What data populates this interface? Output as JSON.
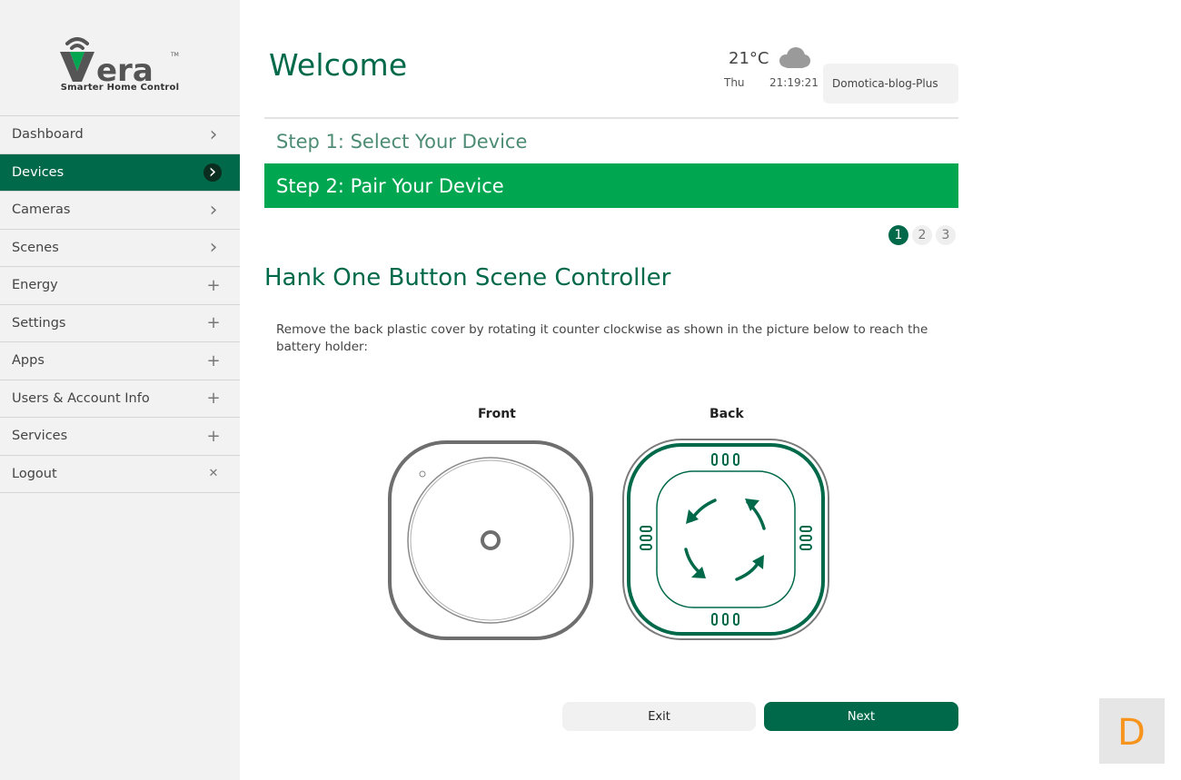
{
  "app": {
    "logo_text": "Vera",
    "logo_tm": "TM",
    "tagline": "Smarter Home Control"
  },
  "sidebar": {
    "items": [
      {
        "label": "Dashboard",
        "indicator": "chevron-right-icon",
        "active": false
      },
      {
        "label": "Devices",
        "indicator": "chevron-right-icon",
        "active": true
      },
      {
        "label": "Cameras",
        "indicator": "chevron-right-icon",
        "active": false
      },
      {
        "label": "Scenes",
        "indicator": "chevron-right-icon",
        "active": false
      },
      {
        "label": "Energy",
        "indicator": "plus-icon",
        "active": false
      },
      {
        "label": "Settings",
        "indicator": "plus-icon",
        "active": false
      },
      {
        "label": "Apps",
        "indicator": "plus-icon",
        "active": false
      },
      {
        "label": "Users & Account Info",
        "indicator": "plus-icon",
        "active": false
      },
      {
        "label": "Services",
        "indicator": "plus-icon",
        "active": false
      },
      {
        "label": "Logout",
        "indicator": "close-icon",
        "active": false
      }
    ]
  },
  "header": {
    "title": "Welcome",
    "temperature": "21°C",
    "weather_icon": "cloud-icon",
    "day": "Thu",
    "time": "21:19:21",
    "account_name": "Domotica-blog-Plus"
  },
  "wizard": {
    "step1_label": "Step 1: Select Your Device",
    "step2_label": "Step 2: Pair Your Device",
    "pages": [
      "1",
      "2",
      "3"
    ],
    "current_page": "1",
    "device_title": "Hank One Button Scene Controller",
    "instructions": "Remove the back plastic cover by rotating it counter clockwise as shown in the picture below to reach the battery holder:",
    "front_label": "Front",
    "back_label": "Back",
    "exit_label": "Exit",
    "next_label": "Next"
  },
  "watermark": {
    "letter": "D"
  },
  "colors": {
    "brand_dark_green": "#00694a",
    "active_step_green": "#00a650",
    "sidebar_bg": "#f2f2f2",
    "watermark_orange": "#f7941d"
  }
}
